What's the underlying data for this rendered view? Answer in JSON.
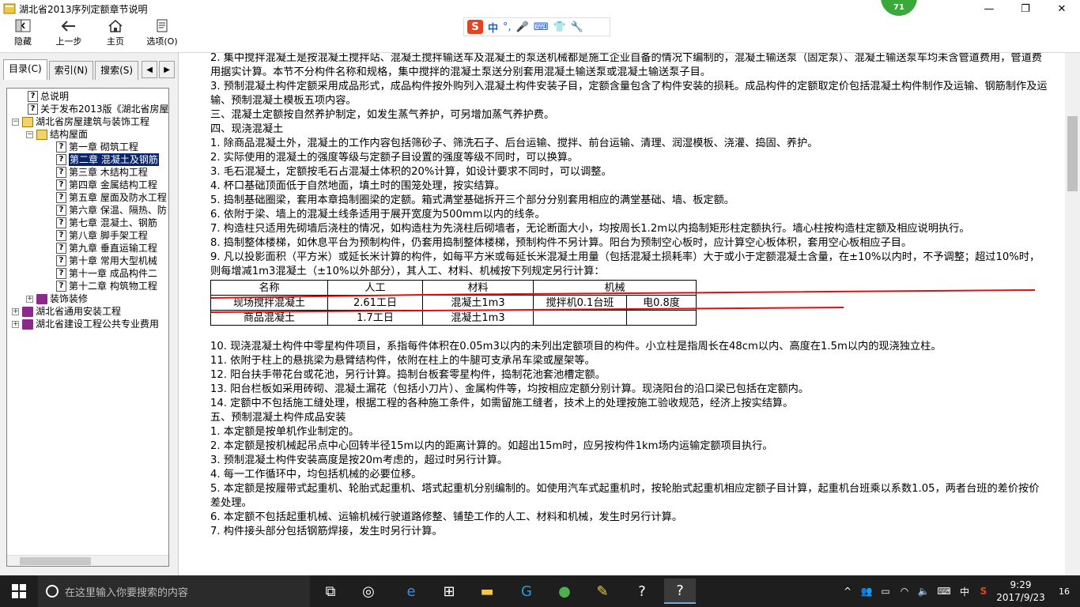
{
  "window": {
    "title": "湖北省2013序列定额章节说明",
    "badge": "71",
    "controls": [
      "—",
      "❐",
      "✕"
    ]
  },
  "toolbar": {
    "hide": "隐藏",
    "back": "上一步",
    "home": "主页",
    "options": "选项(O)"
  },
  "ime": {
    "mode": "中"
  },
  "tabs": {
    "contents": "目录(C)",
    "index": "索引(N)",
    "search": "搜索(S)"
  },
  "tree": {
    "n0": "总说明",
    "n1": "关于发布2013版《湖北省房屋",
    "n2": "湖北省房屋建筑与装饰工程",
    "n3": "结构屋面",
    "c1": "第一章 砌筑工程",
    "c2": "第二章 混凝土及钢筋",
    "c3": "第三章 木结构工程",
    "c4": "第四章 金属结构工程",
    "c5": "第五章 屋面及防水工程",
    "c6": "第六章 保温、隔热、防",
    "c7": "第七章 混凝土、钢筋",
    "c8": "第八章 脚手架工程",
    "c9": "第九章 垂直运输工程",
    "c10": "第十章 常用大型机械",
    "c11": "第十一章 成品构件二",
    "c12": "第十二章 构筑物工程",
    "n4": "装饰装修",
    "n5": "湖北省通用安装工程",
    "n6": "湖北省建设工程公共专业费用"
  },
  "doc": {
    "p1": "2. 集中搅拌混凝土是按混凝土搅拌站、混凝土搅拌输送车及混凝土的泵送机械都是施工企业自备的情况下编制的，混凝土输送泵（固定泵）、混凝土输送泵车均未含管道费用，管道费用据实计算。本节不分构件名称和规格，集中搅拌的混凝土泵送分别套用混凝土输送泵或混凝土输送泵子目。",
    "p2": "3. 预制混凝土构件定额采用成品形式，成品构件按外购列入混凝土构件安装子目，定额含量包含了构件安装的损耗。成品构件的定额取定价包括混凝土构件制作及运输、钢筋制作及运输、预制混凝土模板五项内容。",
    "p3": "三、混凝土定额按自然养护制定，如发生蒸气养护，可另增加蒸气养护费。",
    "p4": "四、现浇混凝土",
    "p5": "1. 除商品混凝土外，混凝土的工作内容包括筛砂子、筛洗石子、后台运输、搅拌、前台运输、清理、润湿模板、浇灌、捣固、养护。",
    "p6": "2. 实际使用的混凝土的强度等级与定额子目设置的强度等级不同时，可以换算。",
    "p7": "3. 毛石混凝土，定额按毛石占混凝土体积的20%计算，如设计要求不同时，可以调整。",
    "p8": "4. 杯口基础顶面低于自然地面，填土时的围笼处理，按实结算。",
    "p9": "5. 捣制基础圈梁，套用本章捣制圈梁的定额。箱式满堂基础拆开三个部分分别套用相应的满堂基础、墙、板定额。",
    "p10": "6. 依附于梁、墙上的混凝土线条适用于展开宽度为500mm以内的线条。",
    "p11": "7. 构造柱只适用先砌墙后浇柱的情况，如构造柱为先浇柱后砌墙者，无论断面大小，均按周长1.2m以内捣制矩形柱定额执行。墙心柱按构造柱定额及相应说明执行。",
    "p12": "8. 捣制整体楼梯，如休息平台为预制构件，仍套用捣制整体楼梯，预制构件不另计算。阳台为预制空心板时，应计算空心板体积，套用空心板相应子目。",
    "p13": "9. 凡以投影面积（平方米）或延长米计算的构件，如每平方米或每延长米混凝土用量（包括混凝土损耗率）大于或小于定额混凝土含量，在±10%以内时，不予调整；超过10%时，则每增减1m3混凝土（±10%以外部分），其人工、材料、机械按下列规定另行计算：",
    "p14": "10. 现浇混凝土构件中零星构件项目，系指每件体积在0.05m3以内的未列出定额项目的构件。小立柱是指周长在48cm以内、高度在1.5m以内的现浇独立柱。",
    "p15": "11. 依附于柱上的悬挑梁为悬臂结构件，依附在柱上的牛腿可支承吊车梁或屋架等。",
    "p16": "12. 阳台扶手带花台或花池，另行计算。捣制台板套零星构件，捣制花池套池槽定额。",
    "p17": "13. 阳台栏板如采用砖砌、混凝土漏花（包括小刀片）、金属构件等，均按相应定额分别计算。现浇阳台的沿口梁已包括在定额内。",
    "p18": "14. 定额中不包括施工缝处理，根据工程的各种施工条件，如需留施工缝者，技术上的处理按施工验收规范，经济上按实结算。",
    "p19": "五、预制混凝土构件成品安装",
    "p20": "1. 本定额是按单机作业制定的。",
    "p21": "2. 本定额是按机械起吊点中心回转半径15m以内的距离计算的。如超出15m时，应另按构件1km场内运输定额项目执行。",
    "p22": "3. 预制混凝土构件安装高度是按20m考虑的，超过时另行计算。",
    "p23": "4. 每一工作循环中，均包括机械的必要位移。",
    "p24": "5. 本定额是按履带式起重机、轮胎式起重机、塔式起重机分别编制的。如使用汽车式起重机时，按轮胎式起重机相应定额子目计算，起重机台班乘以系数1.05，两者台班的差价按价差处理。",
    "p25": "6. 本定额不包括起重机械、运输机械行驶道路修整、铺垫工作的人工、材料和机械，发生时另行计算。",
    "p26": "7. 构件接头部分包括钢筋焊接，发生时另行计算。"
  },
  "table": {
    "headers": [
      "名称",
      "人工",
      "材料",
      "机械"
    ],
    "rows": [
      [
        "现场搅拌混凝土",
        "2.61工日",
        "混凝土1m3",
        "搅拌机0.1台班",
        "电0.8度"
      ],
      [
        "商品混凝土",
        "1.7工日",
        "混凝土1m3",
        "",
        ""
      ]
    ]
  },
  "taskbar": {
    "search_placeholder": "在这里输入你要搜索的内容",
    "lang": "中",
    "time": "9:29",
    "date": "2017/9/23",
    "notif_count": "16"
  }
}
